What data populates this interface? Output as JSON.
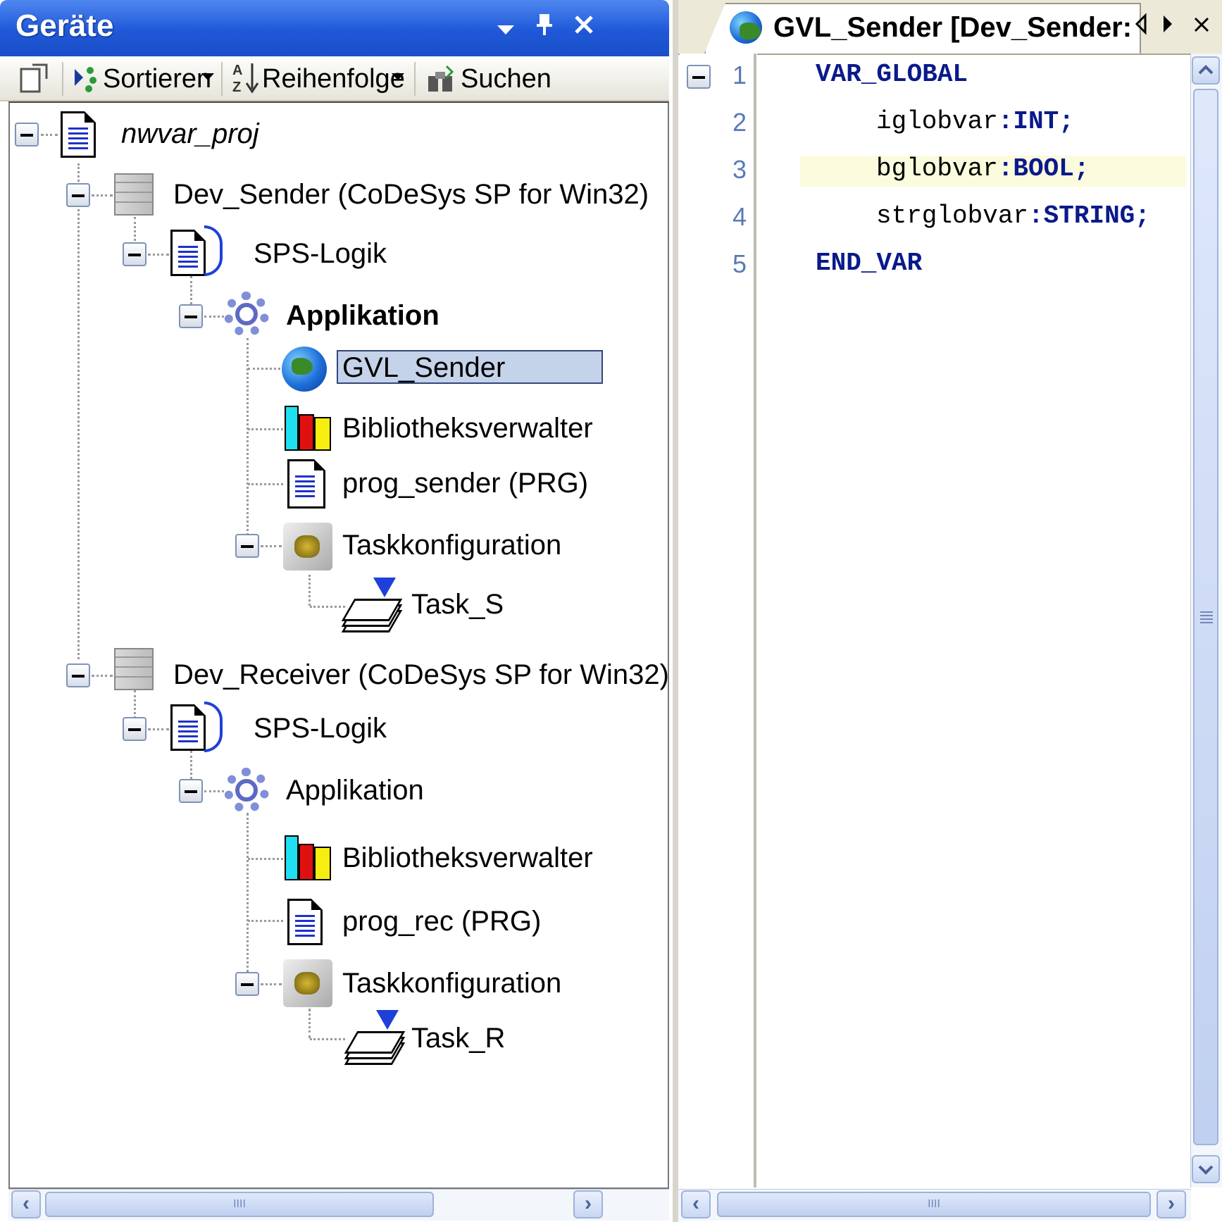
{
  "left_panel": {
    "title": "Geräte",
    "controls": {
      "dropdown": "chevron-down-icon",
      "pin": "pin-icon",
      "close": "close-icon"
    },
    "toolbar": {
      "sort_label": "Sortieren",
      "order_label": "Reihenfolge",
      "search_label": "Suchen"
    },
    "tree": {
      "project": "nwvar_proj",
      "sender": {
        "device": "Dev_Sender (CoDeSys SP for Win32)",
        "plc_logic": "SPS-Logik",
        "application": "Applikation",
        "gvl": "GVL_Sender",
        "library_manager": "Bibliotheksverwalter",
        "program": "prog_sender (PRG)",
        "task_config": "Taskkonfiguration",
        "task": "Task_S"
      },
      "receiver": {
        "device": "Dev_Receiver (CoDeSys SP for Win32)",
        "plc_logic": "SPS-Logik",
        "application": "Applikation",
        "library_manager": "Bibliotheksverwalter",
        "program": "prog_rec (PRG)",
        "task_config": "Taskkonfiguration",
        "task": "Task_R"
      }
    }
  },
  "editor": {
    "tab_title": "GVL_Sender [Dev_Sender: SPS-Logik: Applikation]",
    "lines": [
      {
        "num": "1",
        "indent": false,
        "parts": [
          {
            "t": "VAR_GLOBAL",
            "kw": true
          }
        ]
      },
      {
        "num": "2",
        "indent": true,
        "parts": [
          {
            "t": "iglobvar",
            "kw": false
          },
          {
            "t": ":INT;",
            "kw": true
          }
        ]
      },
      {
        "num": "3",
        "indent": true,
        "parts": [
          {
            "t": "bglobvar",
            "kw": false
          },
          {
            "t": ":BOOL;",
            "kw": true
          }
        ]
      },
      {
        "num": "4",
        "indent": true,
        "parts": [
          {
            "t": "strglobvar",
            "kw": false
          },
          {
            "t": ":STRING;",
            "kw": true
          }
        ]
      },
      {
        "num": "5",
        "indent": false,
        "parts": [
          {
            "t": "END_VAR",
            "kw": true
          }
        ]
      }
    ],
    "highlighted_line": "3"
  },
  "scrollbars": {
    "grip": "IIII"
  }
}
